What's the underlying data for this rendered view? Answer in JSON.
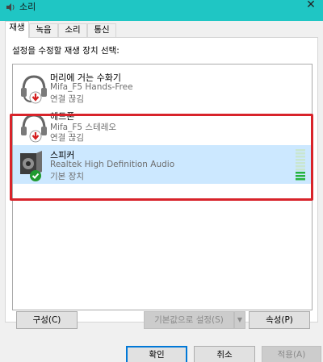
{
  "window": {
    "title": "소리",
    "close_glyph": "✕"
  },
  "tabs": [
    {
      "label": "재생",
      "active": true
    },
    {
      "label": "녹음",
      "active": false
    },
    {
      "label": "소리",
      "active": false
    },
    {
      "label": "통신",
      "active": false
    }
  ],
  "instruction": "설정을 수정할 재생 장치 선택:",
  "devices": [
    {
      "name": "머리에 거는 수화기",
      "description": "Mifa_F5 Hands-Free",
      "status": "연결 끊김",
      "icon": "headset-icon",
      "badge": "disconnected-arrow-icon",
      "selected": false
    },
    {
      "name": "헤드폰",
      "description": "Mifa_F5 스테레오",
      "status": "연결 끊김",
      "icon": "headphones-icon",
      "badge": "disconnected-arrow-icon",
      "selected": false
    },
    {
      "name": "스피커",
      "description": "Realtek High Definition Audio",
      "status": "기본 장치",
      "icon": "speaker-icon",
      "badge": "default-check-icon",
      "selected": true,
      "level": 0.3
    }
  ],
  "buttons": {
    "configure": "구성(C)",
    "set_default": "기본값으로 설정(S)",
    "properties": "속성(P)",
    "ok": "확인",
    "cancel": "취소",
    "apply": "적용(A)"
  },
  "colors": {
    "titlebar": "#1fc6c4",
    "selection": "#cce8ff",
    "highlight": "#d8232a",
    "badge_red": "#d42020",
    "badge_green": "#1f9a2f"
  }
}
